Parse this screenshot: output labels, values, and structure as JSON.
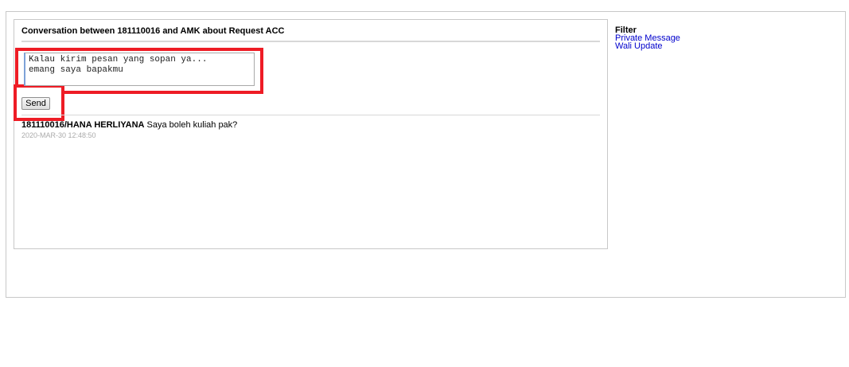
{
  "conversation": {
    "title": "Conversation between 181110016 and AMK about Request ACC",
    "reply": {
      "text": "Kalau kirim pesan yang sopan ya...\nemang saya bapakmu",
      "send_label": "Send"
    },
    "messages": [
      {
        "sender": "181110016/HANA HERLIYANA",
        "text": "Saya boleh kuliah pak?",
        "timestamp": "2020-MAR-30 12:48:50"
      }
    ]
  },
  "filter": {
    "heading": "Filter",
    "links": [
      "Private Message",
      "Wali Update"
    ]
  },
  "colors": {
    "highlight": "#ee1c25",
    "link": "#0000cc",
    "timestamp": "#aaaaaa"
  }
}
